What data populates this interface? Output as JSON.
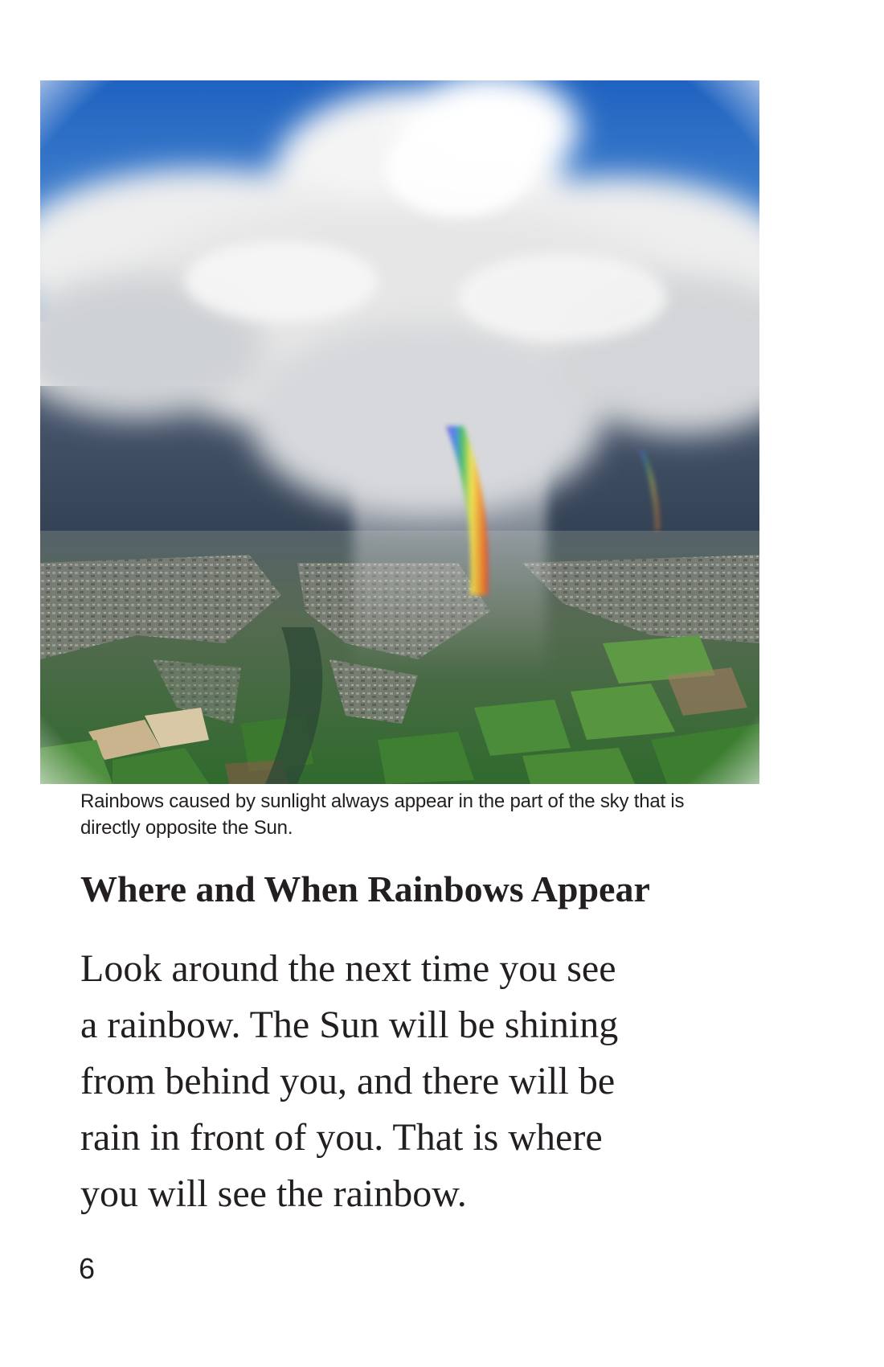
{
  "photo": {
    "subject": "aerial view of rain cloud with rainbow over landscape",
    "colors": {
      "sky": "#2f73c9",
      "cloud": "#f2f2f2",
      "storm": "#3a4a5e",
      "land": "#3d6b3a",
      "town": "#8a8a80"
    }
  },
  "caption": "Rainbows caused by sunlight always appear in the part of the sky that is directly opposite the Sun.",
  "heading": "Where and When Rainbows Appear",
  "body": {
    "lines": [
      "Look around the next time you see",
      "a rainbow. The Sun will be shining",
      "from behind you, and there will be",
      "rain in front of you. That is where",
      "you will see the rainbow."
    ]
  },
  "page_number": "6"
}
